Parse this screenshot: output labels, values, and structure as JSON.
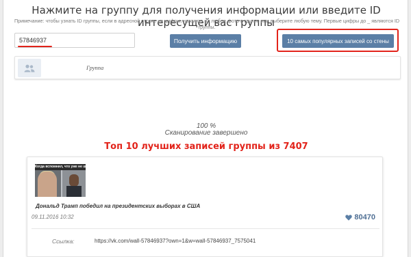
{
  "header": {
    "title": "Нажмите на группу для получения информации или введите ID интересущей вас группы",
    "hint": "Примечание: чтобы узнать ID группы, если в адресной строке не цифры, нажмите на любое фото в группе или выберите любую тему. Первые цифры до _ являются ID группы."
  },
  "search": {
    "value": "57846937",
    "get_info_label": "Получить информацию",
    "top_posts_label": "10 самых популярных записей со стены"
  },
  "group": {
    "avatar_icon": "users-icon",
    "name": "Группа"
  },
  "progress": {
    "percent_text": "100 %",
    "status": "Сканирование завершено"
  },
  "results": {
    "title": "Топ 10 лучших записей группы из 7407"
  },
  "post": {
    "image_caption": "Когда вспомнил, что уже не школьник",
    "text": "Дональд Трамп победил на президентских выборах в США",
    "date": "09.11.2016 10:32",
    "likes": "80470",
    "likes_icon": "heart-icon",
    "link_label": "Ссылка:",
    "link_url": "https://vk.com/wall-57846937?own=1&w=wall-57846937_7575041"
  },
  "colors": {
    "accent_button": "#5b7fa6",
    "highlight_red": "#e2231a",
    "likes_blue": "#4f6f94"
  }
}
